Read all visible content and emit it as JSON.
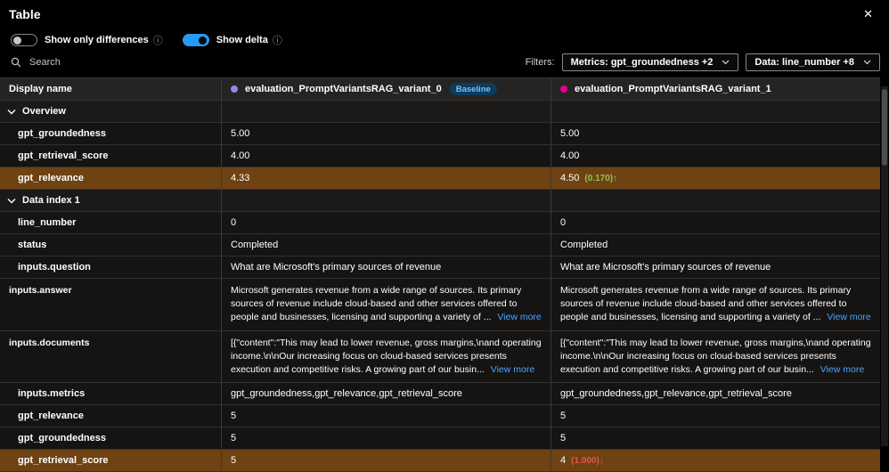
{
  "window": {
    "title": "Table",
    "close_icon": "✕"
  },
  "toolbar": {
    "show_only_differences": {
      "label": "Show only differences",
      "state": "off"
    },
    "show_delta": {
      "label": "Show delta",
      "state": "on"
    },
    "info_icon": "ⓘ"
  },
  "search": {
    "placeholder": "Search"
  },
  "filters": {
    "label": "Filters:",
    "metrics_dropdown": "Metrics: gpt_groundedness +2",
    "data_dropdown": "Data: line_number +8"
  },
  "colors": {
    "toggle_on": "#2899f5",
    "variant0_dot": "#8b8cf0",
    "variant1_dot": "#e3008c",
    "row_highlight": "#6e4212",
    "delta_up": "#92c353",
    "delta_down": "#e25744",
    "link": "#4da3ff",
    "baseline_badge_bg": "#0c3b5e",
    "baseline_badge_text": "#7cc0f0"
  },
  "table": {
    "header": {
      "display_name": "Display name",
      "variant0": "evaluation_PromptVariantsRAG_variant_0",
      "variant0_badge": "Baseline",
      "variant1": "evaluation_PromptVariantsRAG_variant_1"
    },
    "rows": [
      {
        "type": "group",
        "label": "Overview"
      },
      {
        "type": "data",
        "label": "gpt_groundedness",
        "v0": "5.00",
        "v1": "5.00"
      },
      {
        "type": "data",
        "label": "gpt_retrieval_score",
        "v0": "4.00",
        "v1": "4.00"
      },
      {
        "type": "data",
        "label": "gpt_relevance",
        "v0": "4.33",
        "v1": "4.50",
        "delta": "(0.170)↑",
        "highlight": true
      },
      {
        "type": "group",
        "label": "Data index 1"
      },
      {
        "type": "data",
        "label": "line_number",
        "v0": "0",
        "v1": "0"
      },
      {
        "type": "data",
        "label": "status",
        "v0": "Completed",
        "v1": "Completed"
      },
      {
        "type": "data",
        "label": "inputs.question",
        "v0": "What are Microsoft's primary sources of revenue",
        "v1": "What are Microsoft's primary sources of revenue"
      },
      {
        "type": "data",
        "label": "inputs.answer",
        "v0": "Microsoft generates revenue from a wide range of sources. Its primary sources of revenue include cloud-based and other services offered to people and businesses, licensing and supporting a variety of ...",
        "v0_link": "View more",
        "v1": "Microsoft generates revenue from a wide range of sources. Its primary sources of revenue include cloud-based and other services offered to people and businesses, licensing and supporting a variety of ...",
        "v1_link": "View more"
      },
      {
        "type": "data",
        "label": "inputs.documents",
        "v0": "[{\"content\":\"This may lead to lower revenue, gross margins,\\nand operating income.\\n\\nOur increasing focus on cloud-based services presents execution and competitive risks. A growing part of our busin...",
        "v0_link": "View more",
        "v1": "[{\"content\":\"This may lead to lower revenue, gross margins,\\nand operating income.\\n\\nOur increasing focus on cloud-based services presents execution and competitive risks. A growing part of our busin...",
        "v1_link": "View more"
      },
      {
        "type": "data",
        "label": "inputs.metrics",
        "v0": "gpt_groundedness,gpt_relevance,gpt_retrieval_score",
        "v1": "gpt_groundedness,gpt_relevance,gpt_retrieval_score"
      },
      {
        "type": "data",
        "label": "gpt_relevance",
        "v0": "5",
        "v1": "5"
      },
      {
        "type": "data",
        "label": "gpt_groundedness",
        "v0": "5",
        "v1": "5"
      },
      {
        "type": "data",
        "label": "gpt_retrieval_score",
        "v0": "5",
        "v1": "4",
        "delta": "(1.000)↓",
        "highlight": true
      }
    ]
  }
}
